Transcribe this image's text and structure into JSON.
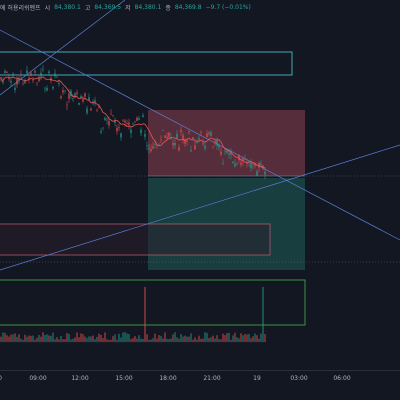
{
  "header": {
    "symbol_suffix": "에 허용리쉬멘프",
    "open_label": "시",
    "open_value": "84,380.1",
    "high_label": "고",
    "high_value": "84,369.5",
    "low_label": "저",
    "low_value": "84,380.1",
    "close_label": "종",
    "close_value": "84,369.8",
    "change": "−9.7 (−0.01%)"
  },
  "time_axis": {
    "labels": [
      "0",
      "09:00",
      "12:00",
      "15:00",
      "18:00",
      "21:00",
      "19",
      "03:00",
      "06:00"
    ]
  },
  "colors": {
    "background": "#131722",
    "up": "#26a69a",
    "down": "#ef5350",
    "ma_line": "#ef5350",
    "trendline": "#5b7fd6",
    "box_blue": "#4dd0e1",
    "box_red": "#b2566c",
    "box_green": "#4caf50",
    "long_position_red": "#a84a5a",
    "long_position_green": "#1f5f5a"
  }
}
